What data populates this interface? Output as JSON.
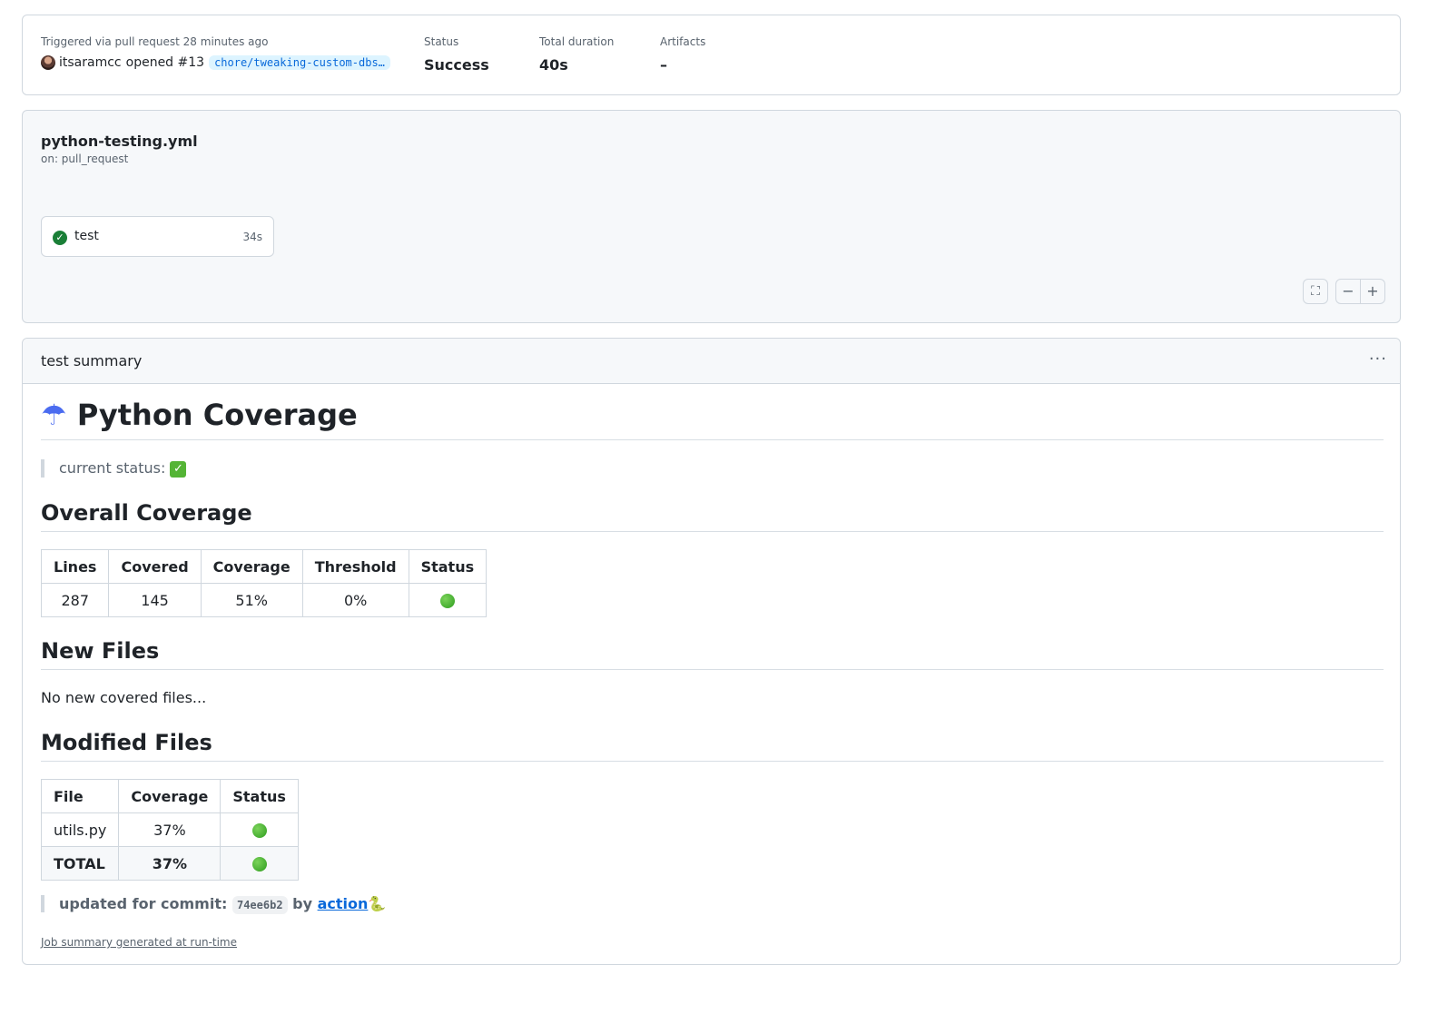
{
  "run": {
    "triggered_text": "Triggered via pull request 28 minutes ago",
    "actor": "itsaramcc",
    "action_text": "opened #13",
    "branch": "chore/tweaking-custom-dbs…",
    "status_label": "Status",
    "status_value": "Success",
    "duration_label": "Total duration",
    "duration_value": "40s",
    "artifacts_label": "Artifacts",
    "artifacts_value": "–"
  },
  "workflow": {
    "file": "python-testing.yml",
    "on": "on: pull_request",
    "job": {
      "name": "test",
      "duration": "34s",
      "status_icon": "check-circle-icon"
    },
    "controls": {
      "fullscreen": "⛶",
      "zoom_out": "−",
      "zoom_in": "+"
    }
  },
  "summary": {
    "title": "test summary",
    "menu": "···",
    "heading": "Python Coverage",
    "heading_icon": "☂",
    "current_status_label": "current status:",
    "current_status_icon": "✓",
    "overall_heading": "Overall Coverage",
    "overall_table": {
      "headers": [
        "Lines",
        "Covered",
        "Coverage",
        "Threshold",
        "Status"
      ],
      "row": [
        "287",
        "145",
        "51%",
        "0%"
      ]
    },
    "new_files_heading": "New Files",
    "new_files_text": "No new covered files...",
    "modified_heading": "Modified Files",
    "modified_table": {
      "headers": [
        "File",
        "Coverage",
        "Status"
      ],
      "rows": [
        {
          "file": "utils.py",
          "coverage": "37%"
        },
        {
          "file": "TOTAL",
          "coverage": "37%"
        }
      ]
    },
    "commit_prefix": "updated for commit:",
    "commit_sha": "74ee6b2",
    "by_text": "by",
    "action_link": "action",
    "snake_icon": "🐍",
    "footnote": "Job summary generated at run-time"
  },
  "colors": {
    "success": "#1a7f37",
    "link": "#0969da",
    "border": "#d0d7de"
  }
}
